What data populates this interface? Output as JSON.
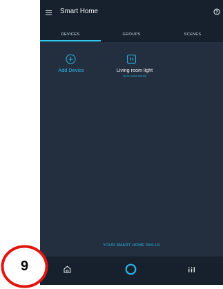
{
  "app": {
    "title": "Smart Home"
  },
  "tabs": [
    {
      "label": "DEVICES",
      "selected": true
    },
    {
      "label": "GROUPS",
      "selected": false
    },
    {
      "label": "SCENES",
      "selected": false
    }
  ],
  "tiles": {
    "add_device": {
      "label": "Add Device",
      "icon": "plus-circle-icon"
    },
    "device": {
      "name": "Living room light",
      "hint": "Tap to control and edit",
      "icon": "smart-plug-icon"
    }
  },
  "footer": {
    "skills_link": "YOUR SMART HOME SKILLS"
  },
  "bottom_nav": [
    {
      "icon": "home-icon"
    },
    {
      "icon": "alexa-ring-icon"
    },
    {
      "icon": "devices-icon"
    }
  ],
  "annotation": {
    "number": "9",
    "color": "#e0160f"
  },
  "colors": {
    "accent": "#2cb5e8",
    "background": "#232f3e",
    "bar": "#17212d"
  }
}
